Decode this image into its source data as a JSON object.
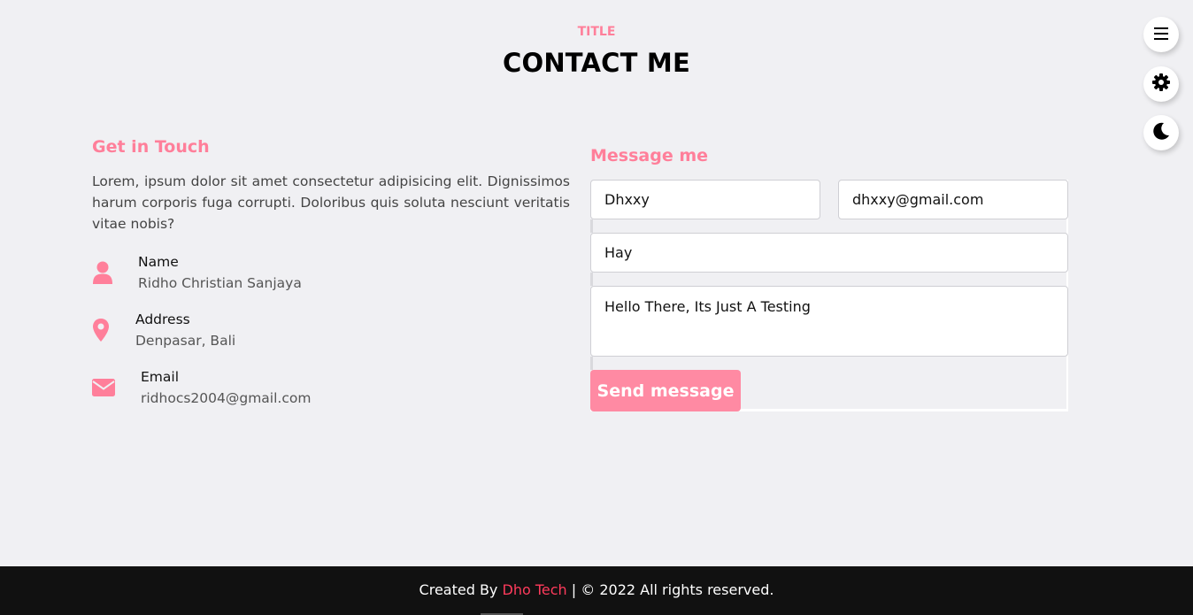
{
  "header": {
    "title": "TITLE",
    "heading": "CONTACT ME"
  },
  "contact_info": {
    "heading": "Get in Touch",
    "description": "Lorem, ipsum dolor sit amet consectetur adipisicing elit. Dignissimos harum corporis fuga corrupti. Doloribus quis soluta nesciunt veritatis vitae nobis?",
    "items": [
      {
        "icon": "user-icon",
        "title": "Name",
        "value": "Ridho Christian Sanjaya"
      },
      {
        "icon": "map-pin-icon",
        "title": "Address",
        "value": "Denpasar, Bali"
      },
      {
        "icon": "envelope-icon",
        "title": "Email",
        "value": "ridhocs2004@gmail.com"
      }
    ]
  },
  "form": {
    "heading": "Message me",
    "name_value": "Dhxxy",
    "email_value": "dhxxy@gmail.com",
    "subject_value": "Hay",
    "message_value": "Hello There, Its Just A Testing",
    "submit_label": "Send message"
  },
  "side_buttons": [
    "menu-icon",
    "gear-icon",
    "moon-icon"
  ],
  "footer": {
    "prefix": "Created By",
    "brand": "Dho Tech",
    "suffix": "| © 2022 All rights reserved."
  },
  "colors": {
    "accent": "#ff7f9a",
    "button": "#ff8aa3",
    "footer_bg": "#111111",
    "brand_text": "#ff3b5c",
    "page_bg": "#f0f0f3"
  }
}
